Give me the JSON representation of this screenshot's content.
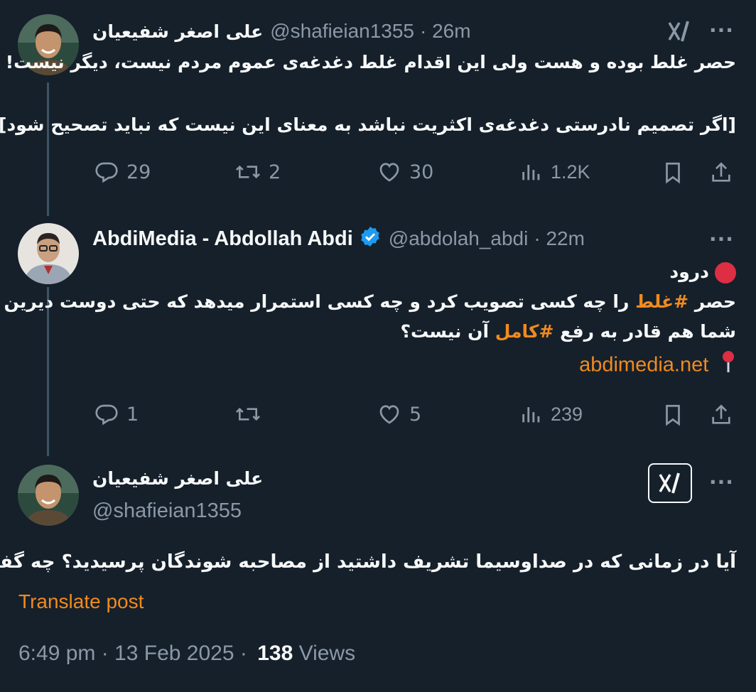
{
  "tweet1": {
    "display_name": "علی اصغر شفیعیان",
    "handle": "@shafieian1355",
    "time": "· 26m",
    "line1": "حصر غلط بوده و  هست ولی این اقدام غلط دغدغه‌ی عموم مردم نیست، دیگر نیست!",
    "line2": "[اگر تصمیم نادرستی دغدغه‌ی اکثریت نباشد به معنای این نیست که نباید تصحیح شود]",
    "replies": "29",
    "reposts": "2",
    "likes": "30",
    "views": "1.2K",
    "more": "···"
  },
  "tweet2": {
    "display_name": "AbdiMedia - Abdollah Abdi",
    "handle": "@abdolah_abdi",
    "time": "· 22m",
    "greeting": "درود",
    "line2_a": "حصر ",
    "hashtag1": "#غلط",
    "line2_b": " را چه کسی تصویب کرد و چه کسی استمرار میدهد که حتی دوست دیرین",
    "line3_a": "شما هم قادر به رفع ",
    "hashtag2": "#کامل",
    "line3_b": " آن نیست؟",
    "link": "abdimedia.net",
    "replies": "1",
    "reposts": "",
    "likes": "5",
    "views": "239",
    "more": "···"
  },
  "tweet3": {
    "display_name": "علی اصغر شفیعیان",
    "handle": "@shafieian1355",
    "text": "آیا در زمانی که در صداوسیما تشریف داشتید از مصاحبه شوندگان پرسیدید؟ چه گفتند؟",
    "translate": "Translate post",
    "date": "6:49 pm · 13 Feb 2025 ·",
    "views_count": "138",
    "views_label": "Views",
    "more": "···"
  },
  "colors": {
    "background": "#15202b",
    "muted": "#8b98a5",
    "accent": "#f18a1e",
    "verified": "#1d9bf0",
    "thread_line": "#3d5466"
  },
  "icons": [
    "reply-icon",
    "repost-icon",
    "like-icon",
    "views-icon",
    "bookmark-icon",
    "share-icon",
    "grok-icon",
    "verified-icon",
    "red-circle-icon",
    "pin-icon"
  ]
}
